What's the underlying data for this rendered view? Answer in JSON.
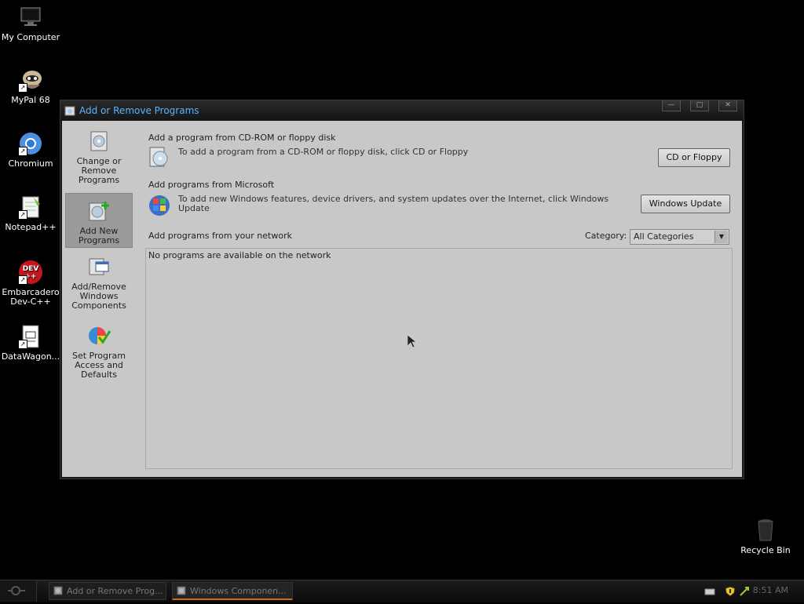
{
  "desktop": {
    "icons": [
      {
        "label": "My Computer",
        "icon": "monitor-icon"
      },
      {
        "label": "MyPal 68",
        "icon": "raccoon-icon"
      },
      {
        "label": "Chromium",
        "icon": "chromium-icon"
      },
      {
        "label": "Notepad++",
        "icon": "notepad-icon"
      },
      {
        "label": "Embarcadero Dev-C++",
        "icon": "devcpp-icon"
      },
      {
        "label": "DataWagon...",
        "icon": "document-icon"
      }
    ],
    "recycle_bin": "Recycle Bin",
    "devcpp_badge": "DEV\n++"
  },
  "window": {
    "title": "Add or Remove Programs",
    "controls": {
      "minimize": "—",
      "maximize": "□",
      "close": "✕"
    }
  },
  "nav": [
    {
      "label": "Change or Remove Programs",
      "selected": false
    },
    {
      "label": "Add New Programs",
      "selected": true
    },
    {
      "label": "Add/Remove Windows Components",
      "selected": false
    },
    {
      "label": "Set Program Access and Defaults",
      "selected": false
    }
  ],
  "main": {
    "cd_section": {
      "title": "Add a program from CD-ROM or floppy disk",
      "desc": "To add a program from a CD-ROM or floppy disk, click CD or Floppy",
      "button": "CD or Floppy"
    },
    "ms_section": {
      "title": "Add programs from Microsoft",
      "desc": "To add new Windows features, device drivers, and system updates over the Internet, click Windows Update",
      "button": "Windows Update"
    },
    "network_section": {
      "title": "Add programs from your network",
      "category_label": "Category:",
      "category_value": "All Categories",
      "empty_message": "No programs are available on the network"
    }
  },
  "taskbar": {
    "tasks": [
      {
        "label": "Add or Remove Prog...",
        "active": false
      },
      {
        "label": "Windows Componen...",
        "active": true
      }
    ],
    "clock": "8:51 AM"
  },
  "colors": {
    "title_text": "#5ab4ff",
    "client_bg": "#c8c8c8",
    "active_task_accent": "#d06b18"
  }
}
